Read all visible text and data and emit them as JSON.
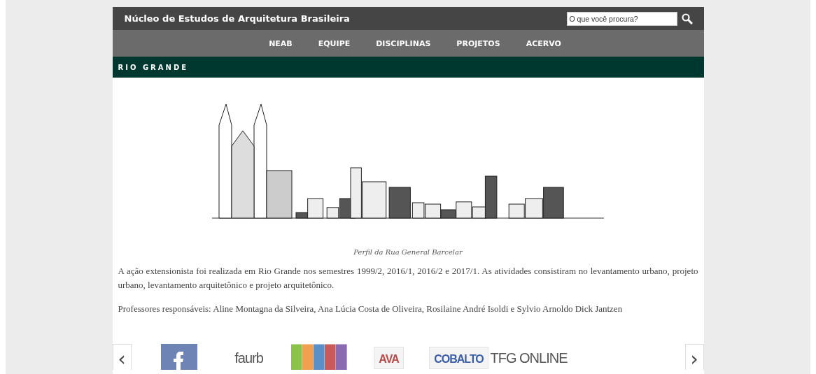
{
  "header": {
    "site_title": "Núcleo de Estudos de Arquitetura Brasileira",
    "search": {
      "placeholder": "O que você procura?"
    }
  },
  "nav": [
    {
      "label": "NEAB"
    },
    {
      "label": "EQUIPE"
    },
    {
      "label": "DISCIPLINAS"
    },
    {
      "label": "PROJETOS"
    },
    {
      "label": "ACERVO"
    }
  ],
  "section_title": "RIO GRANDE",
  "figure": {
    "caption": "Perfil da Rua General Barcelar"
  },
  "paragraphs": [
    "A ação extensionista foi realizada em Rio Grande nos semestres 1999/2, 2016/1, 2016/2 e 2017/1. As atividades consistiram no levantamento urbano, projeto urbano, levantamento arquitetônico e projeto arquitetônico.",
    "Professores responsáveis: Aline Montagna da Silveira, Ana Lúcia Costa de Oliveira, Rosilaine André Isoldi e Sylvio Arnoldo Dick Jantzen"
  ],
  "carousel": {
    "prev": "‹",
    "next": "›",
    "logos": [
      {
        "kind": "facebook"
      },
      {
        "kind": "text",
        "text": "faurb"
      },
      {
        "kind": "calendar"
      },
      {
        "kind": "ava",
        "text": "AVA"
      },
      {
        "kind": "cobalto",
        "text": "COBALTO"
      },
      {
        "kind": "text",
        "text": "TFG ONLINE"
      }
    ]
  }
}
